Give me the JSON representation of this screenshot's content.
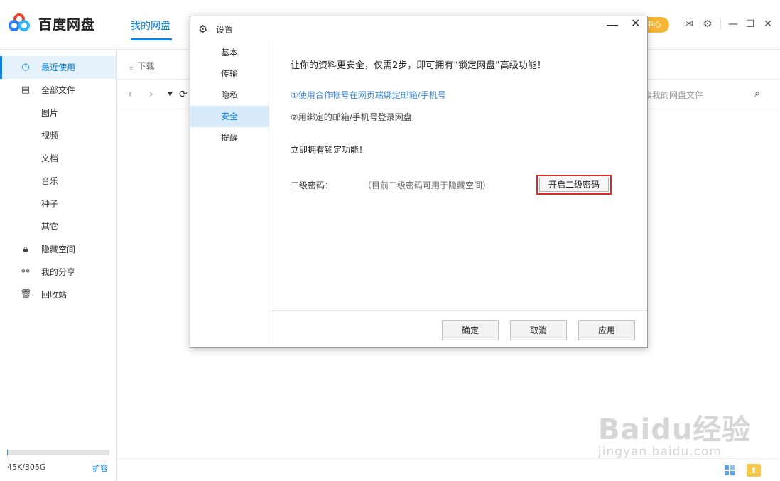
{
  "header": {
    "app_name": "百度网盘",
    "main_tab": "我的网盘",
    "badge": "中心"
  },
  "sidebar": {
    "items": [
      {
        "label": "最近使用",
        "icon": "clock-icon"
      },
      {
        "label": "全部文件",
        "icon": "document-icon"
      },
      {
        "label": "图片"
      },
      {
        "label": "视频"
      },
      {
        "label": "文档"
      },
      {
        "label": "音乐"
      },
      {
        "label": "种子"
      },
      {
        "label": "其它"
      },
      {
        "label": "隐藏空间",
        "icon": "lock-icon"
      },
      {
        "label": "我的分享",
        "icon": "share-icon"
      },
      {
        "label": "回收站",
        "icon": "trash-icon"
      }
    ],
    "quota": {
      "text": "45K/305G",
      "expand": "扩容",
      "used_fraction": 0.01
    }
  },
  "content": {
    "download_label": "下载",
    "search_placeholder": "索我的网盘文件"
  },
  "dialog": {
    "title": "设置",
    "nav": [
      "基本",
      "传输",
      "隐私",
      "安全",
      "提醒"
    ],
    "active_nav": "安全",
    "headline": "让你的资料更安全，仅需2步，即可拥有“锁定网盘”高级功能！",
    "step1": "①使用合作帐号在网页端绑定邮箱/手机号",
    "step2": "②用绑定的邮箱/手机号登录网盘",
    "cta": "立即拥有锁定功能！",
    "pwd_label": "二级密码：",
    "pwd_hint": "（目前二级密码可用于隐藏空间）",
    "pwd_button": "开启二级密码",
    "buttons": {
      "ok": "确定",
      "cancel": "取消",
      "apply": "应用"
    }
  },
  "watermark": {
    "main": "Baidu经验",
    "sub": "jingyan.baidu.com"
  },
  "colors": {
    "accent": "#0a84e6",
    "highlight": "#e02a2a",
    "badge": "#f6b635"
  }
}
